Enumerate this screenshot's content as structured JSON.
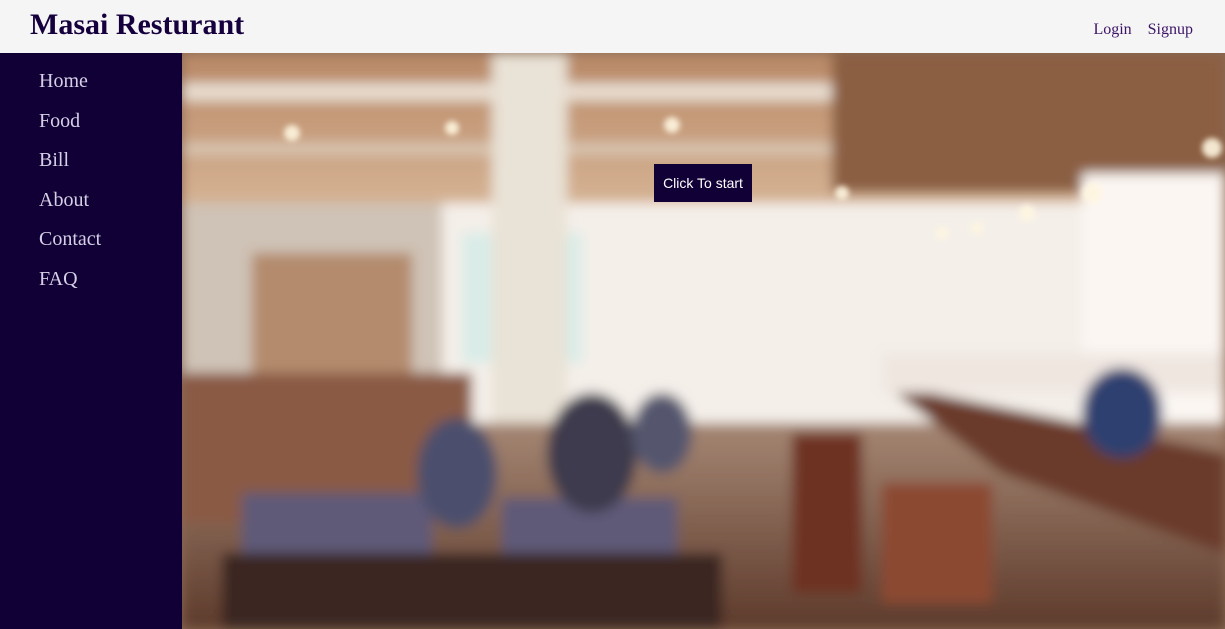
{
  "header": {
    "brand": "Masai Resturant",
    "login_label": "Login",
    "signup_label": "Signup"
  },
  "sidebar": {
    "items": [
      {
        "label": "Home"
      },
      {
        "label": "Food"
      },
      {
        "label": "Bill"
      },
      {
        "label": "About"
      },
      {
        "label": "Contact"
      },
      {
        "label": "FAQ"
      }
    ]
  },
  "hero": {
    "start_label": "Click To start"
  },
  "colors": {
    "brand_dark": "#100036",
    "header_bg": "#f5f5f5",
    "link_purple": "#3b1466"
  }
}
